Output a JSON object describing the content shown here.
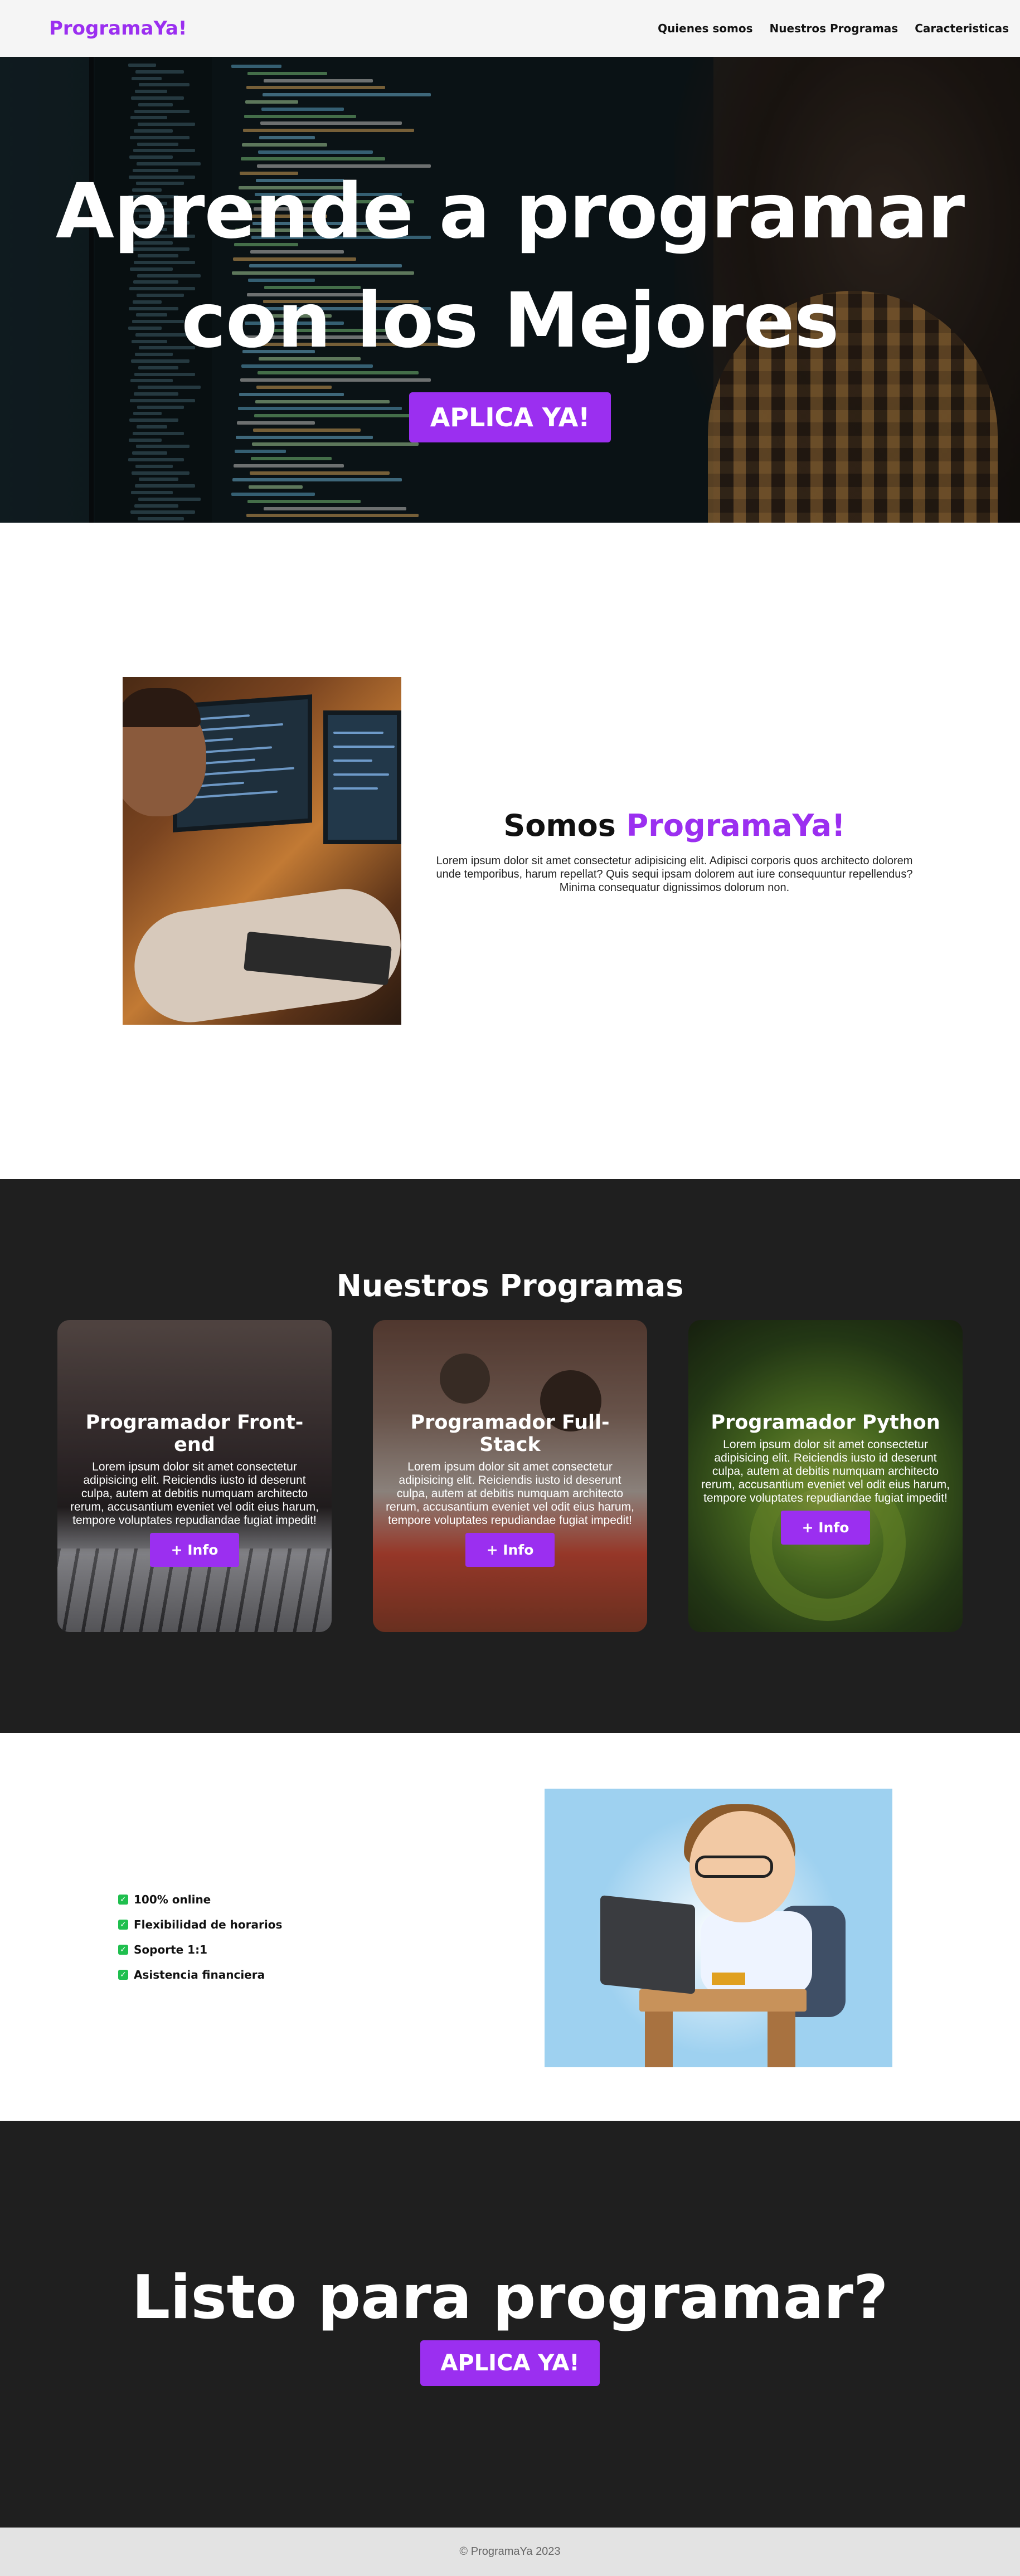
{
  "colors": {
    "accent": "#9b2ff0",
    "dark": "#1f1f1f",
    "check": "#1fbf4e"
  },
  "nav": {
    "brand": "ProgramaYa!",
    "links": [
      "Quienes somos",
      "Nuestros Programas",
      "Caracteristicas"
    ]
  },
  "hero": {
    "title_line1": "Aprende a programar",
    "title_line2": "con los Mejores",
    "button": "APLICA YA!"
  },
  "about": {
    "title_prefix": "Somos ",
    "title_accent": "ProgramaYa!",
    "body": "Lorem ipsum dolor sit amet consectetur adipisicing elit. Adipisci corporis quos architecto dolorem unde temporibus, harum repellat? Quis sequi ipsam dolorem aut iure consequuntur repellendus? Minima consequatur dignissimos dolorum non."
  },
  "programs": {
    "title": "Nuestros Programas",
    "cards": [
      {
        "title": "Programador Front-end",
        "text": "Lorem ipsum dolor sit amet consectetur adipisicing elit. Reiciendis iusto id deserunt culpa, autem at debitis numquam architecto rerum, accusantium eveniet vel odit eius harum, tempore voluptates repudiandae fugiat impedit!",
        "button": "+ Info"
      },
      {
        "title": "Programador Full-Stack",
        "text": "Lorem ipsum dolor sit amet consectetur adipisicing elit. Reiciendis iusto id deserunt culpa, autem at debitis numquam architecto rerum, accusantium eveniet vel odit eius harum, tempore voluptates repudiandae fugiat impedit!",
        "button": "+ Info"
      },
      {
        "title": "Programador Python",
        "text": "Lorem ipsum dolor sit amet consectetur adipisicing elit. Reiciendis iusto id deserunt culpa, autem at debitis numquam architecto rerum, accusantium eveniet vel odit eius harum, tempore voluptates repudiandae fugiat impedit!",
        "button": "+ Info"
      }
    ]
  },
  "features": {
    "items": [
      "100% online",
      "Flexibilidad de horarios",
      "Soporte 1:1",
      "Asistencia financiera"
    ],
    "check_icon": "check-icon"
  },
  "cta": {
    "title": "Listo para programar?",
    "button": "APLICA YA!"
  },
  "footer": {
    "text": "© ProgramaYa 2023"
  }
}
